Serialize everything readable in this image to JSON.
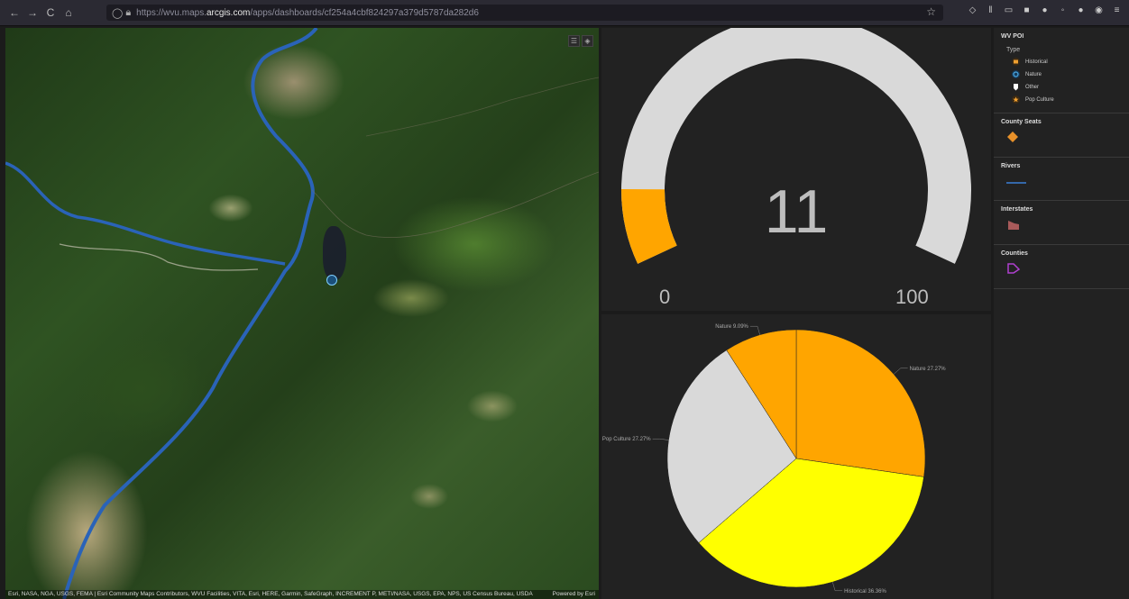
{
  "browser": {
    "back_icon": "←",
    "forward_icon": "→",
    "reload_icon": "C",
    "home_icon": "⌂",
    "url_prefix": "https://wvu.maps.",
    "url_domain": "arcgis.com",
    "url_path": "/apps/dashboards/cf254a4cbf824297a379d5787da282d6",
    "star_icon": "☆"
  },
  "map": {
    "attribution": "Esri, NASA, NGA, USGS, FEMA | Esri Community Maps Contributors, WVU Facilities, VITA, Esri, HERE, Garmin, SafeGraph, INCREMENT P, METI/NASA, USGS, EPA, NPS, US Census Bureau, USDA",
    "powered_by": "Powered by Esri"
  },
  "gauge": {
    "value": "11",
    "min": "0",
    "max": "100",
    "value_number": 11,
    "min_number": 0,
    "max_number": 100,
    "fill_color": "#ffa500",
    "track_color": "#d9d9d9"
  },
  "chart_data": {
    "type": "pie",
    "categories": [
      "Nature",
      "Historical",
      "Pop Culture",
      "Nature"
    ],
    "values": [
      27.27,
      36.36,
      27.27,
      9.09
    ],
    "colors": [
      "#ffa500",
      "#ffff00",
      "#d9d9d9",
      "#ffa500"
    ],
    "labels": [
      "Nature 27.27%",
      "Historical 36.36%",
      "Pop Culture 27.27%",
      "Nature 9.09%"
    ]
  },
  "legend": {
    "wv_poi": {
      "title": "WV POI",
      "subtitle": "Type",
      "items": [
        {
          "label": "Historical",
          "icon": "historical-icon",
          "color": "#f0a030"
        },
        {
          "label": "Nature",
          "icon": "nature-icon",
          "color": "#4aa8e0"
        },
        {
          "label": "Other",
          "icon": "other-icon",
          "color": "#ffffff"
        },
        {
          "label": "Pop Culture",
          "icon": "pop-culture-icon",
          "color": "#f0a030"
        }
      ]
    },
    "county_seats": {
      "title": "County Seats",
      "color": "#e8912a"
    },
    "rivers": {
      "title": "Rivers",
      "color": "#3a7fd8"
    },
    "interstates": {
      "title": "Interstates",
      "color": "#a85a5a"
    },
    "counties": {
      "title": "Counties",
      "color": "#b040d0"
    }
  }
}
